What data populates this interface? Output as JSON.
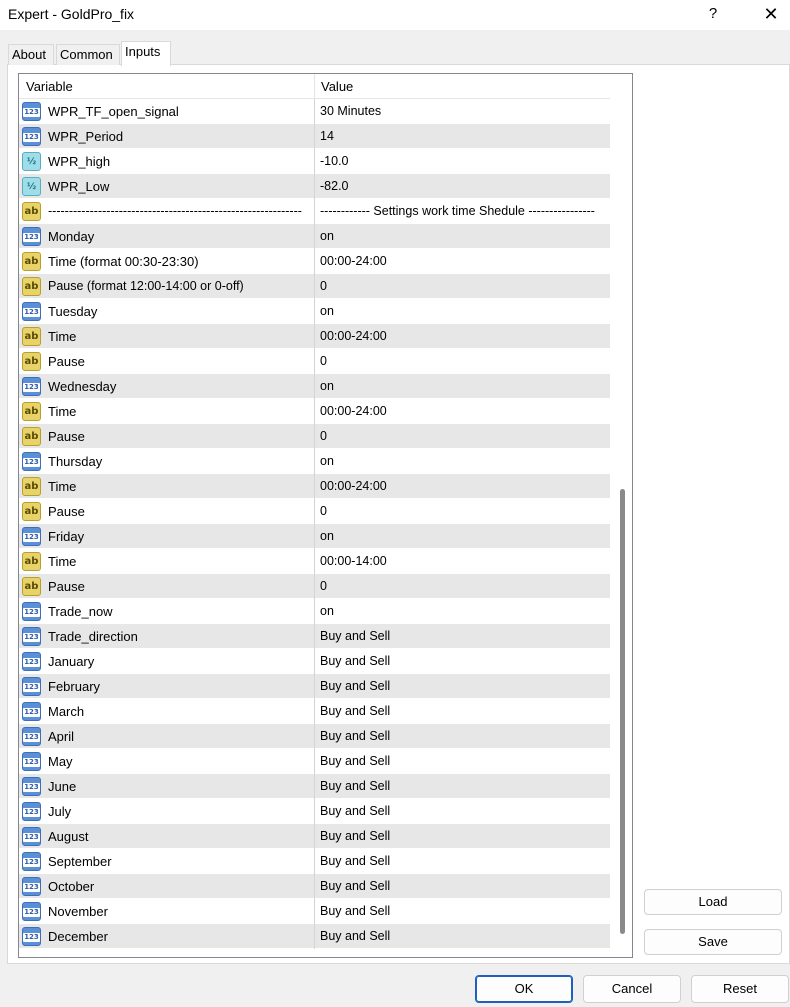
{
  "window": {
    "title": "Expert - GoldPro_fix",
    "help_glyph": "?",
    "close_glyph": "✕"
  },
  "tabs": [
    {
      "label": "About",
      "active": false
    },
    {
      "label": "Common",
      "active": false
    },
    {
      "label": "Inputs",
      "active": true
    }
  ],
  "grid": {
    "columns": [
      "Variable",
      "Value"
    ],
    "rows": [
      {
        "type": "int",
        "variable": "WPR_TF_open_signal",
        "value": "30 Minutes"
      },
      {
        "type": "int",
        "variable": "WPR_Period",
        "value": "14"
      },
      {
        "type": "dbl",
        "variable": "WPR_high",
        "value": "-10.0"
      },
      {
        "type": "dbl",
        "variable": "WPR_Low",
        "value": "-82.0"
      },
      {
        "type": "str",
        "variable": "-------------------------------------------------------------",
        "value": "------------ Settings work time Shedule ----------------"
      },
      {
        "type": "int",
        "variable": "Monday",
        "value": "on"
      },
      {
        "type": "str",
        "variable": "Time (format 00:30-23:30)",
        "value": "00:00-24:00"
      },
      {
        "type": "str",
        "variable": "Pause (format 12:00-14:00 or 0-off)",
        "value": "0"
      },
      {
        "type": "int",
        "variable": "Tuesday",
        "value": "on"
      },
      {
        "type": "str",
        "variable": "Time",
        "value": "00:00-24:00"
      },
      {
        "type": "str",
        "variable": "Pause",
        "value": "0"
      },
      {
        "type": "int",
        "variable": "Wednesday",
        "value": "on"
      },
      {
        "type": "str",
        "variable": "Time",
        "value": "00:00-24:00"
      },
      {
        "type": "str",
        "variable": "Pause",
        "value": "0"
      },
      {
        "type": "int",
        "variable": "Thursday",
        "value": "on"
      },
      {
        "type": "str",
        "variable": "Time",
        "value": "00:00-24:00"
      },
      {
        "type": "str",
        "variable": "Pause",
        "value": "0"
      },
      {
        "type": "int",
        "variable": "Friday",
        "value": "on"
      },
      {
        "type": "str",
        "variable": "Time",
        "value": "00:00-14:00"
      },
      {
        "type": "str",
        "variable": "Pause",
        "value": "0"
      },
      {
        "type": "int",
        "variable": "Trade_now",
        "value": "on"
      },
      {
        "type": "int",
        "variable": "Trade_direction",
        "value": "Buy and Sell"
      },
      {
        "type": "int",
        "variable": "January",
        "value": "Buy and Sell"
      },
      {
        "type": "int",
        "variable": "February",
        "value": "Buy and Sell"
      },
      {
        "type": "int",
        "variable": "March",
        "value": "Buy and Sell"
      },
      {
        "type": "int",
        "variable": "April",
        "value": "Buy and Sell"
      },
      {
        "type": "int",
        "variable": "May",
        "value": "Buy and Sell"
      },
      {
        "type": "int",
        "variable": "June",
        "value": "Buy and Sell"
      },
      {
        "type": "int",
        "variable": "July",
        "value": "Buy and Sell"
      },
      {
        "type": "int",
        "variable": "August",
        "value": "Buy and Sell"
      },
      {
        "type": "int",
        "variable": "September",
        "value": "Buy and Sell"
      },
      {
        "type": "int",
        "variable": "October",
        "value": "Buy and Sell"
      },
      {
        "type": "int",
        "variable": "November",
        "value": "Buy and Sell"
      },
      {
        "type": "int",
        "variable": "December",
        "value": "Buy and Sell"
      }
    ]
  },
  "icons": {
    "int": {
      "name": "integer-type-icon",
      "glyph": "123"
    },
    "dbl": {
      "name": "double-type-icon",
      "glyph": "½"
    },
    "str": {
      "name": "string-type-icon",
      "glyph": "ab"
    }
  },
  "side_buttons": {
    "load": "Load",
    "save": "Save"
  },
  "bottom_buttons": {
    "ok": "OK",
    "cancel": "Cancel",
    "reset": "Reset"
  }
}
